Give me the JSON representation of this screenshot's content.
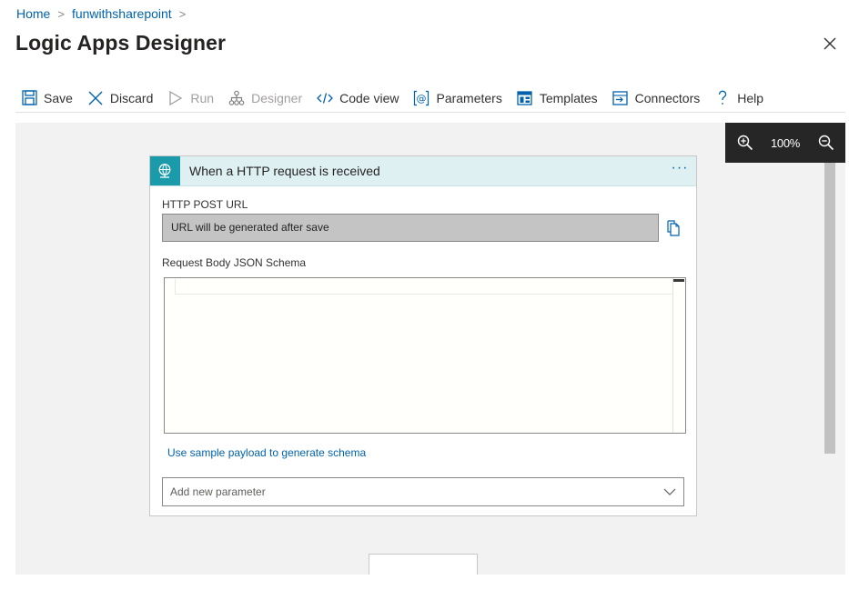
{
  "breadcrumb": {
    "home": "Home",
    "separator": ">",
    "resource": "funwithsharepoint"
  },
  "page": {
    "title": "Logic Apps Designer"
  },
  "toolbar": {
    "save": "Save",
    "discard": "Discard",
    "run": "Run",
    "designer": "Designer",
    "code_view": "Code view",
    "parameters": "Parameters",
    "templates": "Templates",
    "connectors": "Connectors",
    "help": "Help"
  },
  "zoom": {
    "level": "100%"
  },
  "trigger_card": {
    "title": "When a HTTP request is received",
    "menu": "···",
    "accent_color": "#1b9aaa",
    "http_post_url_label": "HTTP POST URL",
    "http_post_url_value": "URL will be generated after save",
    "schema_label": "Request Body JSON Schema",
    "sample_payload_link": "Use sample payload to generate schema",
    "add_parameter_placeholder": "Add new parameter"
  },
  "icons": {
    "save": "save-icon",
    "discard": "discard-x-icon",
    "run": "run-play-icon",
    "designer": "designer-hierarchy-icon",
    "code_view": "code-view-icon",
    "parameters": "parameters-at-icon",
    "templates": "templates-icon",
    "connectors": "connectors-icon",
    "help": "help-question-icon"
  }
}
